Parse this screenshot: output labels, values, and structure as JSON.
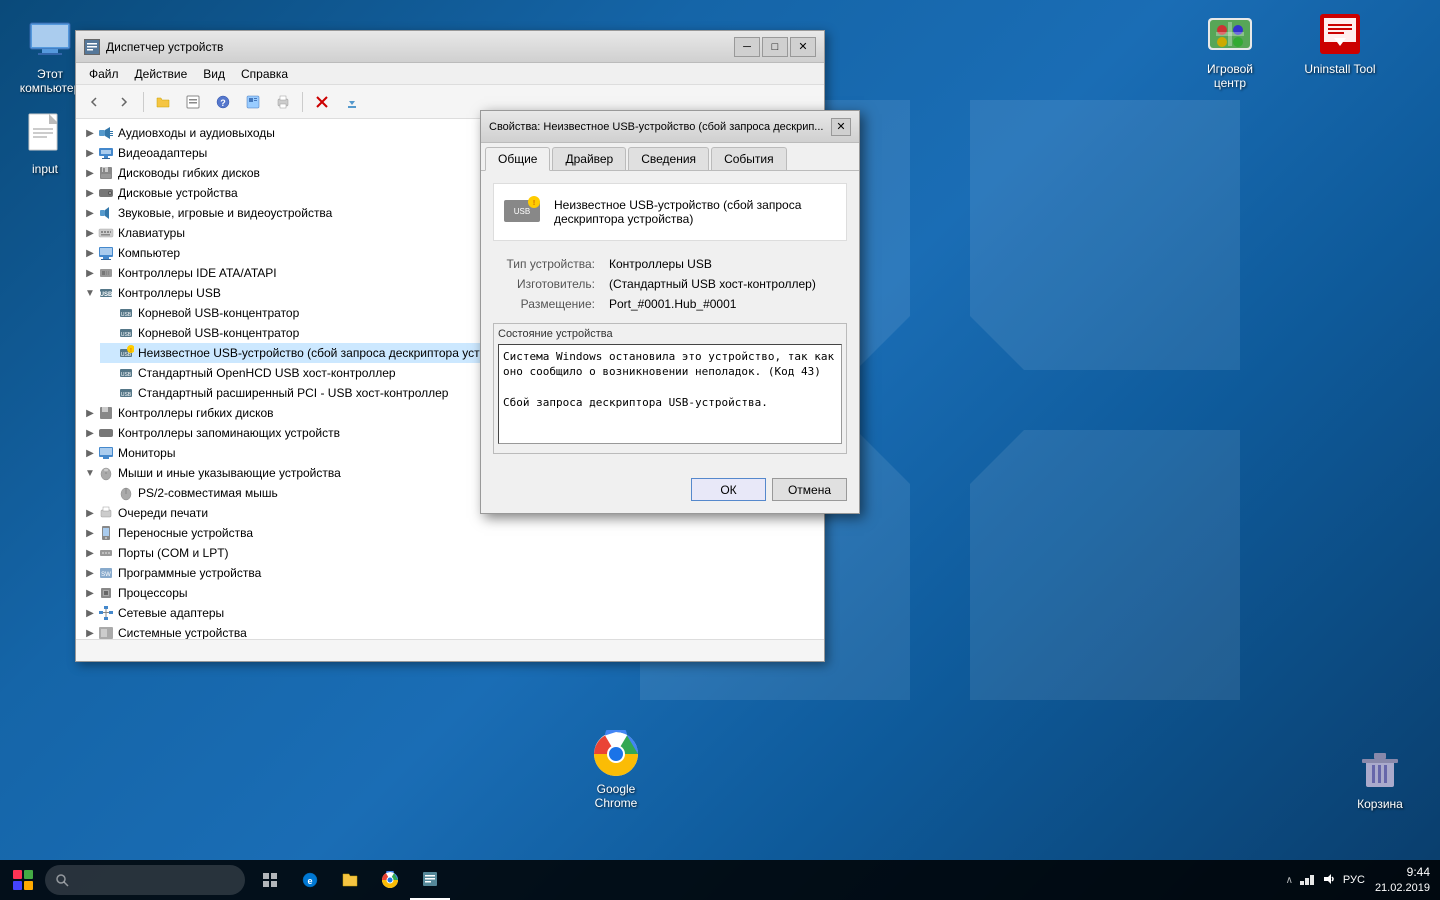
{
  "desktop": {
    "icons": [
      {
        "id": "my-computer",
        "label": "Этот\nкомпьютер",
        "symbol": "💻"
      },
      {
        "id": "input",
        "label": "input",
        "symbol": "📄"
      },
      {
        "id": "chrome",
        "label": "Google\nChrome",
        "symbol": "🌐"
      },
      {
        "id": "recycle",
        "label": "Корзина",
        "symbol": "🗑"
      },
      {
        "id": "game-center",
        "label": "Игровой\nцентр",
        "symbol": "🎮"
      },
      {
        "id": "uninstall-tool",
        "label": "Uninstall\nTool",
        "symbol": "🔧"
      }
    ]
  },
  "devmgr": {
    "title": "Диспетчер устройств",
    "titlebar_icon": "⚙",
    "menus": [
      "Файл",
      "Действие",
      "Вид",
      "Справка"
    ],
    "toolbar": {
      "buttons": [
        "◀",
        "▶",
        "📁",
        "📋",
        "❓",
        "📊",
        "🖨",
        "✕",
        "⬇"
      ]
    },
    "tree": [
      {
        "label": "Аудиовходы и аудиовыходы",
        "level": 0,
        "expanded": false,
        "icon": "🔊"
      },
      {
        "label": "Видеоадаптеры",
        "level": 0,
        "expanded": false,
        "icon": "🖥"
      },
      {
        "label": "Дисководы гибких дисков",
        "level": 0,
        "expanded": false,
        "icon": "💾"
      },
      {
        "label": "Дисковые устройства",
        "level": 0,
        "expanded": false,
        "icon": "💿"
      },
      {
        "label": "Звуковые, игровые и видеоустройства",
        "level": 0,
        "expanded": false,
        "icon": "🎵"
      },
      {
        "label": "Клавиатуры",
        "level": 0,
        "expanded": false,
        "icon": "⌨"
      },
      {
        "label": "Компьютер",
        "level": 0,
        "expanded": false,
        "icon": "💻"
      },
      {
        "label": "Контроллеры IDE ATA/ATAPI",
        "level": 0,
        "expanded": false,
        "icon": "🔌"
      },
      {
        "label": "Контроллеры USB",
        "level": 0,
        "expanded": true,
        "icon": "🔌"
      },
      {
        "label": "Корневой USB-концентратор",
        "level": 1,
        "expanded": false,
        "icon": "🔌"
      },
      {
        "label": "Корневой USB-концентратор",
        "level": 1,
        "expanded": false,
        "icon": "🔌"
      },
      {
        "label": "Неизвестное USB-устройство (сбой запроса дескриптора устройства)",
        "level": 1,
        "expanded": false,
        "icon": "⚠",
        "warning": true,
        "selected": true
      },
      {
        "label": "Стандартный OpenHCD USB хост-контроллер",
        "level": 1,
        "expanded": false,
        "icon": "🔌"
      },
      {
        "label": "Стандартный расширенный PCI - USB хост-контроллер",
        "level": 1,
        "expanded": false,
        "icon": "🔌"
      },
      {
        "label": "Контроллеры гибких дисков",
        "level": 0,
        "expanded": false,
        "icon": "💾"
      },
      {
        "label": "Контроллеры запоминающих устройств",
        "level": 0,
        "expanded": false,
        "icon": "💾"
      },
      {
        "label": "Мониторы",
        "level": 0,
        "expanded": false,
        "icon": "🖥"
      },
      {
        "label": "Мыши и иные указывающие устройства",
        "level": 0,
        "expanded": true,
        "icon": "🖱"
      },
      {
        "label": "PS/2-совместимая мышь",
        "level": 1,
        "expanded": false,
        "icon": "🖱"
      },
      {
        "label": "Очереди печати",
        "level": 0,
        "expanded": false,
        "icon": "🖨"
      },
      {
        "label": "Переносные устройства",
        "level": 0,
        "expanded": false,
        "icon": "📱"
      },
      {
        "label": "Порты (COM и LPT)",
        "level": 0,
        "expanded": false,
        "icon": "🔌"
      },
      {
        "label": "Программные устройства",
        "level": 0,
        "expanded": false,
        "icon": "💻"
      },
      {
        "label": "Процессоры",
        "level": 0,
        "expanded": false,
        "icon": "🔧"
      },
      {
        "label": "Сетевые адаптеры",
        "level": 0,
        "expanded": false,
        "icon": "🌐"
      },
      {
        "label": "Системные устройства",
        "level": 0,
        "expanded": false,
        "icon": "⚙"
      }
    ]
  },
  "properties_dialog": {
    "title": "Свойства: Неизвестное USB-устройство (сбой запроса дескрип...",
    "tabs": [
      "Общие",
      "Драйвер",
      "Сведения",
      "События"
    ],
    "active_tab": "Общие",
    "device_name": "Неизвестное USB-устройство (сбой запроса дескриптора устройства)",
    "props": {
      "device_type_label": "Тип устройства:",
      "device_type_value": "Контроллеры USB",
      "manufacturer_label": "Изготовитель:",
      "manufacturer_value": "(Стандартный USB хост-контроллер)",
      "location_label": "Размещение:",
      "location_value": "Port_#0001.Hub_#0001"
    },
    "status_section": {
      "label": "Состояние устройства",
      "text": "Система Windows остановила это устройство, так как оно сообщило о возникновении неполадок. (Код 43)\r\n\r\nСбой запроса дескриптора USB-устройства."
    },
    "buttons": {
      "ok": "ОК",
      "cancel": "Отмена"
    }
  },
  "taskbar": {
    "time": "9:44",
    "date": "21.02.2019",
    "lang": "РУС",
    "icons": [
      "🪟",
      "🔍",
      "🗔",
      "📁",
      "🌐",
      "📋"
    ]
  }
}
